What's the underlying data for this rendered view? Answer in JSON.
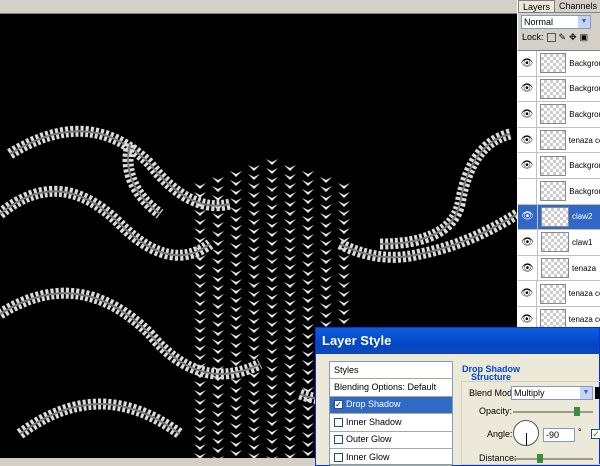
{
  "layers_panel": {
    "tabs": [
      "Layers",
      "Channels"
    ],
    "blend_mode": "Normal",
    "lock_label": "Lock:",
    "layers": [
      {
        "name": "Backgrou",
        "visible": true,
        "selected": false
      },
      {
        "name": "Backgrou",
        "visible": true,
        "selected": false
      },
      {
        "name": "Backgrou",
        "visible": true,
        "selected": false
      },
      {
        "name": "tenaza co",
        "visible": true,
        "selected": false
      },
      {
        "name": "Backgrou",
        "visible": true,
        "selected": false
      },
      {
        "name": "Backgrou",
        "visible": false,
        "selected": false
      },
      {
        "name": "claw2",
        "visible": true,
        "selected": true
      },
      {
        "name": "claw1",
        "visible": true,
        "selected": false
      },
      {
        "name": "tenaza",
        "visible": true,
        "selected": false
      },
      {
        "name": "tenaza co",
        "visible": true,
        "selected": false
      },
      {
        "name": "tenaza co",
        "visible": true,
        "selected": false
      }
    ]
  },
  "dialog": {
    "title": "Layer Style",
    "styles_header": "Styles",
    "items": [
      {
        "label": "Blending Options: Default",
        "checkbox": false,
        "checked": false,
        "selected": false
      },
      {
        "label": "Drop Shadow",
        "checkbox": true,
        "checked": true,
        "selected": true
      },
      {
        "label": "Inner Shadow",
        "checkbox": true,
        "checked": false,
        "selected": false
      },
      {
        "label": "Outer Glow",
        "checkbox": true,
        "checked": false,
        "selected": false
      },
      {
        "label": "Inner Glow",
        "checkbox": true,
        "checked": false,
        "selected": false
      }
    ],
    "section_title": "Drop Shadow",
    "section_sub": "Structure",
    "blend_mode_label": "Blend Mode:",
    "blend_mode_value": "Multiply",
    "opacity_label": "Opacity:",
    "angle_label": "Angle:",
    "angle_value": "-90",
    "degree_symbol": "°",
    "distance_label": "Distance:"
  },
  "colors": {
    "selection": "#3168c7",
    "title_bar": "#0347c5",
    "canvas": "#000000"
  }
}
